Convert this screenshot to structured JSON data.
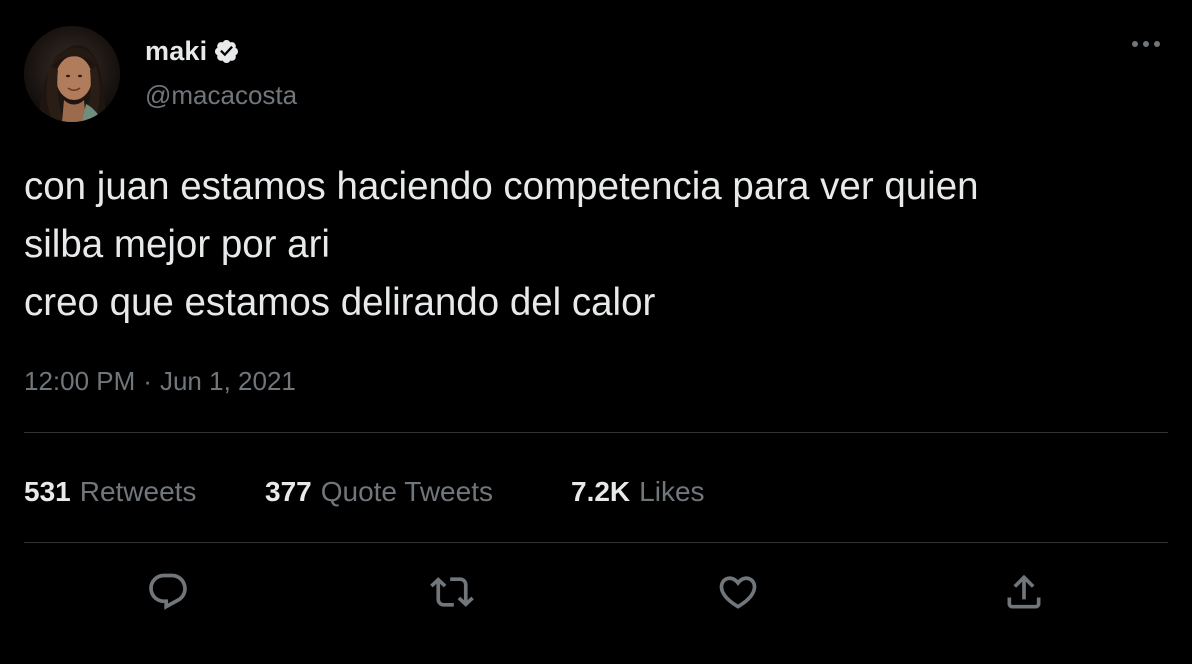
{
  "author": {
    "display_name": "maki",
    "handle": "@macacosta",
    "verified": true,
    "avatar_icon": "profile-photo"
  },
  "tweet": {
    "text": "con juan estamos haciendo competencia para ver quien\nsilba mejor por ari\ncreo que estamos delirando del calor",
    "time": "12:00 PM",
    "separator": "·",
    "date": "Jun 1, 2021"
  },
  "stats": {
    "retweets": {
      "count": "531",
      "label": "Retweets"
    },
    "quote_tweets": {
      "count": "377",
      "label": "Quote Tweets"
    },
    "likes": {
      "count": "7.2K",
      "label": "Likes"
    }
  },
  "actions": {
    "reply_icon": "reply-icon",
    "retweet_icon": "retweet-icon",
    "like_icon": "heart-icon",
    "share_icon": "share-icon"
  },
  "colors": {
    "background": "#000000",
    "text_primary": "#e7e9ea",
    "text_secondary": "#71767b",
    "divider": "#2f3336"
  }
}
